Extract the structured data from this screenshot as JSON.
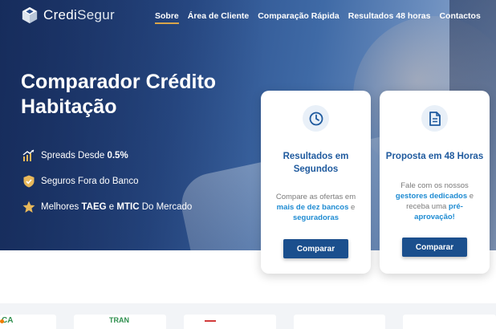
{
  "brand": {
    "name_part1": "Credi",
    "name_part2": "Segur"
  },
  "nav": {
    "items": [
      {
        "label": "Sobre",
        "active": true
      },
      {
        "label": "Área de Cliente",
        "active": false
      },
      {
        "label": "Comparação Rápida",
        "active": false
      },
      {
        "label": "Resultados 48 horas",
        "active": false
      },
      {
        "label": "Contactos",
        "active": false
      }
    ]
  },
  "hero": {
    "title_line1": "Comparador Crédito",
    "title_line2": "Habitação",
    "features": [
      {
        "icon": "growth-chart-icon",
        "pre": "Spreads Desde ",
        "bold": "0.5%",
        "post": ""
      },
      {
        "icon": "shield-check-icon",
        "pre": "Seguros Fora do Banco",
        "bold": "",
        "post": ""
      },
      {
        "icon": "star-icon",
        "pre": "Melhores ",
        "bold": "TAEG",
        "mid": " e ",
        "bold2": "MTIC",
        "post": " Do Mercado"
      }
    ]
  },
  "cards": [
    {
      "icon": "clock-icon",
      "title": "Resultados em Segundos",
      "desc_pre": "Compare as ofertas em ",
      "desc_hl": "mais de dez bancos",
      "desc_mid": " e ",
      "desc_hl2": "seguradoras",
      "button": "Comparar"
    },
    {
      "icon": "document-icon",
      "title": "Proposta em 48 Horas",
      "desc_pre": "Fale com os nossos ",
      "desc_hl": "gestores dedicados",
      "desc_mid": " e receba uma ",
      "desc_hl2": "pré-aprovação!",
      "button": "Comparar"
    }
  ],
  "partners": {
    "labels": [
      "CA",
      "TRAN",
      "",
      "",
      ""
    ]
  },
  "colors": {
    "accent": "#d9a54a",
    "primary": "#1b4f8d",
    "highlight": "#1e8bd2",
    "title": "#1f5a9e"
  }
}
